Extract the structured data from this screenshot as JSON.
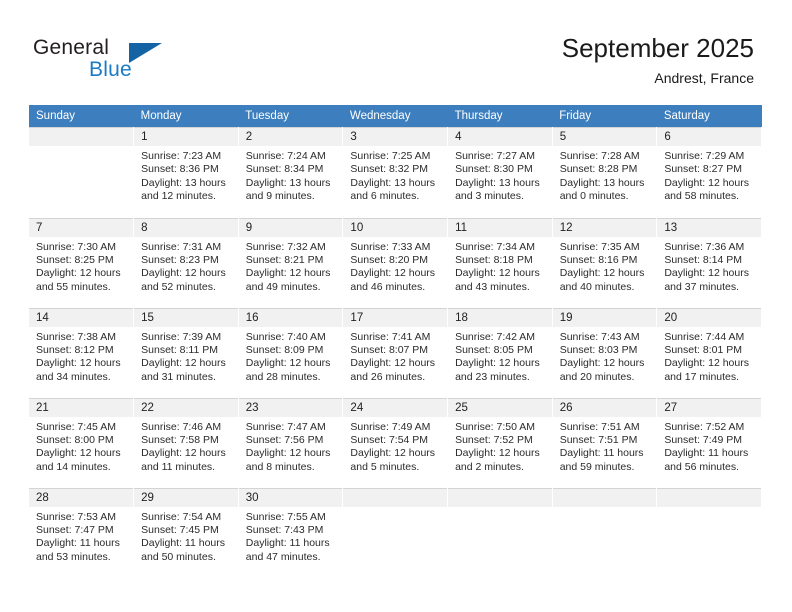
{
  "brand": {
    "name_top": "General",
    "name_bottom": "Blue",
    "triangle_color": "#1464a5",
    "blue_color": "#1a7ac4"
  },
  "header": {
    "title": "September 2025",
    "subtitle": "Andrest, France"
  },
  "theme": {
    "header_row_bg": "#3c7ebe",
    "daynum_bg": "#f1f1f1",
    "grid_line": "#d4d4d4",
    "text": "#2b2b2b"
  },
  "weekdays": [
    "Sunday",
    "Monday",
    "Tuesday",
    "Wednesday",
    "Thursday",
    "Friday",
    "Saturday"
  ],
  "weeks": [
    [
      {
        "day": "",
        "sunrise": "",
        "sunset": "",
        "daylight": "",
        "empty": true
      },
      {
        "day": "1",
        "sunrise": "Sunrise: 7:23 AM",
        "sunset": "Sunset: 8:36 PM",
        "daylight": "Daylight: 13 hours and 12 minutes."
      },
      {
        "day": "2",
        "sunrise": "Sunrise: 7:24 AM",
        "sunset": "Sunset: 8:34 PM",
        "daylight": "Daylight: 13 hours and 9 minutes."
      },
      {
        "day": "3",
        "sunrise": "Sunrise: 7:25 AM",
        "sunset": "Sunset: 8:32 PM",
        "daylight": "Daylight: 13 hours and 6 minutes."
      },
      {
        "day": "4",
        "sunrise": "Sunrise: 7:27 AM",
        "sunset": "Sunset: 8:30 PM",
        "daylight": "Daylight: 13 hours and 3 minutes."
      },
      {
        "day": "5",
        "sunrise": "Sunrise: 7:28 AM",
        "sunset": "Sunset: 8:28 PM",
        "daylight": "Daylight: 13 hours and 0 minutes."
      },
      {
        "day": "6",
        "sunrise": "Sunrise: 7:29 AM",
        "sunset": "Sunset: 8:27 PM",
        "daylight": "Daylight: 12 hours and 58 minutes."
      }
    ],
    [
      {
        "day": "7",
        "sunrise": "Sunrise: 7:30 AM",
        "sunset": "Sunset: 8:25 PM",
        "daylight": "Daylight: 12 hours and 55 minutes."
      },
      {
        "day": "8",
        "sunrise": "Sunrise: 7:31 AM",
        "sunset": "Sunset: 8:23 PM",
        "daylight": "Daylight: 12 hours and 52 minutes."
      },
      {
        "day": "9",
        "sunrise": "Sunrise: 7:32 AM",
        "sunset": "Sunset: 8:21 PM",
        "daylight": "Daylight: 12 hours and 49 minutes."
      },
      {
        "day": "10",
        "sunrise": "Sunrise: 7:33 AM",
        "sunset": "Sunset: 8:20 PM",
        "daylight": "Daylight: 12 hours and 46 minutes."
      },
      {
        "day": "11",
        "sunrise": "Sunrise: 7:34 AM",
        "sunset": "Sunset: 8:18 PM",
        "daylight": "Daylight: 12 hours and 43 minutes."
      },
      {
        "day": "12",
        "sunrise": "Sunrise: 7:35 AM",
        "sunset": "Sunset: 8:16 PM",
        "daylight": "Daylight: 12 hours and 40 minutes."
      },
      {
        "day": "13",
        "sunrise": "Sunrise: 7:36 AM",
        "sunset": "Sunset: 8:14 PM",
        "daylight": "Daylight: 12 hours and 37 minutes."
      }
    ],
    [
      {
        "day": "14",
        "sunrise": "Sunrise: 7:38 AM",
        "sunset": "Sunset: 8:12 PM",
        "daylight": "Daylight: 12 hours and 34 minutes."
      },
      {
        "day": "15",
        "sunrise": "Sunrise: 7:39 AM",
        "sunset": "Sunset: 8:11 PM",
        "daylight": "Daylight: 12 hours and 31 minutes."
      },
      {
        "day": "16",
        "sunrise": "Sunrise: 7:40 AM",
        "sunset": "Sunset: 8:09 PM",
        "daylight": "Daylight: 12 hours and 28 minutes."
      },
      {
        "day": "17",
        "sunrise": "Sunrise: 7:41 AM",
        "sunset": "Sunset: 8:07 PM",
        "daylight": "Daylight: 12 hours and 26 minutes."
      },
      {
        "day": "18",
        "sunrise": "Sunrise: 7:42 AM",
        "sunset": "Sunset: 8:05 PM",
        "daylight": "Daylight: 12 hours and 23 minutes."
      },
      {
        "day": "19",
        "sunrise": "Sunrise: 7:43 AM",
        "sunset": "Sunset: 8:03 PM",
        "daylight": "Daylight: 12 hours and 20 minutes."
      },
      {
        "day": "20",
        "sunrise": "Sunrise: 7:44 AM",
        "sunset": "Sunset: 8:01 PM",
        "daylight": "Daylight: 12 hours and 17 minutes."
      }
    ],
    [
      {
        "day": "21",
        "sunrise": "Sunrise: 7:45 AM",
        "sunset": "Sunset: 8:00 PM",
        "daylight": "Daylight: 12 hours and 14 minutes."
      },
      {
        "day": "22",
        "sunrise": "Sunrise: 7:46 AM",
        "sunset": "Sunset: 7:58 PM",
        "daylight": "Daylight: 12 hours and 11 minutes."
      },
      {
        "day": "23",
        "sunrise": "Sunrise: 7:47 AM",
        "sunset": "Sunset: 7:56 PM",
        "daylight": "Daylight: 12 hours and 8 minutes."
      },
      {
        "day": "24",
        "sunrise": "Sunrise: 7:49 AM",
        "sunset": "Sunset: 7:54 PM",
        "daylight": "Daylight: 12 hours and 5 minutes."
      },
      {
        "day": "25",
        "sunrise": "Sunrise: 7:50 AM",
        "sunset": "Sunset: 7:52 PM",
        "daylight": "Daylight: 12 hours and 2 minutes."
      },
      {
        "day": "26",
        "sunrise": "Sunrise: 7:51 AM",
        "sunset": "Sunset: 7:51 PM",
        "daylight": "Daylight: 11 hours and 59 minutes."
      },
      {
        "day": "27",
        "sunrise": "Sunrise: 7:52 AM",
        "sunset": "Sunset: 7:49 PM",
        "daylight": "Daylight: 11 hours and 56 minutes."
      }
    ],
    [
      {
        "day": "28",
        "sunrise": "Sunrise: 7:53 AM",
        "sunset": "Sunset: 7:47 PM",
        "daylight": "Daylight: 11 hours and 53 minutes."
      },
      {
        "day": "29",
        "sunrise": "Sunrise: 7:54 AM",
        "sunset": "Sunset: 7:45 PM",
        "daylight": "Daylight: 11 hours and 50 minutes."
      },
      {
        "day": "30",
        "sunrise": "Sunrise: 7:55 AM",
        "sunset": "Sunset: 7:43 PM",
        "daylight": "Daylight: 11 hours and 47 minutes."
      },
      {
        "day": "",
        "sunrise": "",
        "sunset": "",
        "daylight": "",
        "empty": true
      },
      {
        "day": "",
        "sunrise": "",
        "sunset": "",
        "daylight": "",
        "empty": true
      },
      {
        "day": "",
        "sunrise": "",
        "sunset": "",
        "daylight": "",
        "empty": true
      },
      {
        "day": "",
        "sunrise": "",
        "sunset": "",
        "daylight": "",
        "empty": true
      }
    ]
  ]
}
